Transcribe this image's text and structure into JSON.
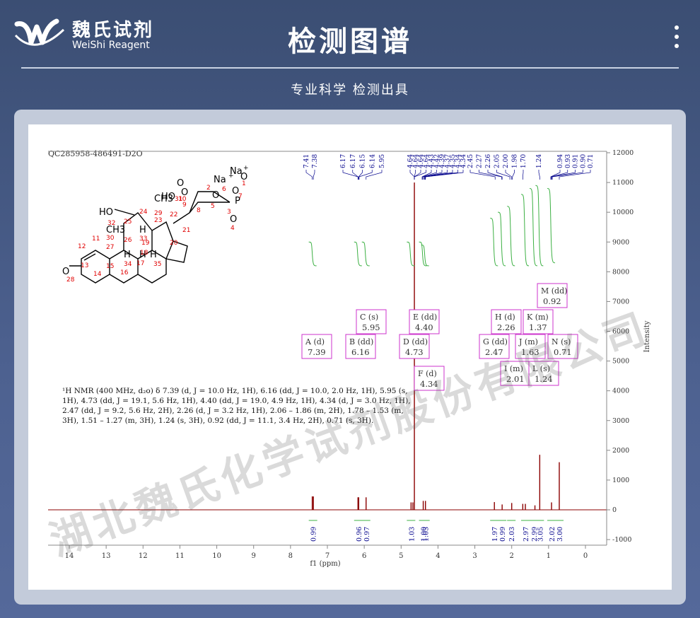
{
  "header": {
    "brand_cn": "魏氏试剂",
    "brand_en": "WeiShi Reagent",
    "title": "检测图谱",
    "subtitle": "专业科学  检测出具"
  },
  "spectrum": {
    "sample_id": "QC285958-486491-D2O",
    "nmr_text": [
      "¹H NMR (400 MHz, d₂o) δ 7.39 (d, J = 10.0 Hz, 1H), 6.16 (dd, J = 10.0, 2.0 Hz, 1H), 5.95 (s,",
      "1H), 4.73 (dd, J = 19.1, 5.6 Hz, 1H), 4.40 (dd, J = 19.0, 4.9 Hz, 1H), 4.34 (d, J = 3.0 Hz, 1H),",
      "2.47 (dd, J = 9.2, 5.6 Hz, 2H), 2.26 (d, J = 3.2 Hz, 1H), 2.06 – 1.86 (m, 2H), 1.78 – 1.53 (m,",
      "3H), 1.51 – 1.27 (m, 3H), 1.24 (s, 3H), 0.92 (dd, J = 11.1, 3.4 Hz, 2H), 0.71 (s, 3H)."
    ],
    "watermark": "湖北魏氏化学试剂股份有限公司"
  },
  "chart_data": {
    "type": "line",
    "xlabel": "f1 (ppm)",
    "ylabel": "Intensity",
    "xlim": [
      14.5,
      -0.6
    ],
    "ylim": [
      -1100,
      12100
    ],
    "x_ticks": [
      "14",
      "13",
      "12",
      "11",
      "10",
      "9",
      "8",
      "7",
      "6",
      "5",
      "4",
      "3",
      "2",
      "1",
      "0"
    ],
    "y_ticks": [
      "12000",
      "11000",
      "10000",
      "9000",
      "8000",
      "7000",
      "6000",
      "5000",
      "4000",
      "3000",
      "2000",
      "1000",
      "0",
      "-1000"
    ],
    "top_labels": [
      "7.41",
      "7.38",
      "6.17",
      "6.17",
      "6.15",
      "6.14",
      "5.95",
      "4.64",
      "4.64",
      "4.64",
      "4.64",
      "4.43",
      "4.42",
      "4.39",
      "4.37",
      "4.35",
      "4.34",
      "4.34",
      "2.45",
      "2.27",
      "2.26",
      "2.05",
      "2.00",
      "1.98",
      "1.70",
      "1.24",
      "0.94",
      "0.93",
      "0.91",
      "0.90",
      "0.71"
    ],
    "peaks": [
      {
        "x": 7.41,
        "y": 450
      },
      {
        "x": 7.38,
        "y": 450
      },
      {
        "x": 6.17,
        "y": 420
      },
      {
        "x": 6.15,
        "y": 420
      },
      {
        "x": 5.95,
        "y": 420
      },
      {
        "x": 4.73,
        "y": 250
      },
      {
        "x": 4.68,
        "y": 250
      },
      {
        "x": 4.64,
        "y": 11000
      },
      {
        "x": 4.4,
        "y": 300
      },
      {
        "x": 4.34,
        "y": 300
      },
      {
        "x": 2.47,
        "y": 260
      },
      {
        "x": 2.26,
        "y": 180
      },
      {
        "x": 2.0,
        "y": 230
      },
      {
        "x": 1.7,
        "y": 200
      },
      {
        "x": 1.63,
        "y": 200
      },
      {
        "x": 1.37,
        "y": 150
      },
      {
        "x": 1.24,
        "y": 1850
      },
      {
        "x": 0.92,
        "y": 250
      },
      {
        "x": 0.71,
        "y": 1600
      }
    ],
    "integrals": [
      {
        "x": 7.39,
        "value": "0.99"
      },
      {
        "x": 6.16,
        "value": "0.96"
      },
      {
        "x": 5.95,
        "value": "0.97"
      },
      {
        "x": 4.73,
        "value": "1.03"
      },
      {
        "x": 4.4,
        "value": "1.00"
      },
      {
        "x": 4.34,
        "value": "1.03"
      },
      {
        "x": 2.47,
        "value": "1.97"
      },
      {
        "x": 2.26,
        "value": "0.99"
      },
      {
        "x": 2.01,
        "value": "2.03"
      },
      {
        "x": 1.63,
        "value": "2.97"
      },
      {
        "x": 1.4,
        "value": "2.99"
      },
      {
        "x": 1.24,
        "value": "3.05"
      },
      {
        "x": 0.92,
        "value": "2.02"
      },
      {
        "x": 0.71,
        "value": "3.00"
      }
    ],
    "multiplets": [
      {
        "id": "A",
        "mult": "d",
        "ppm": "7.39"
      },
      {
        "id": "B",
        "mult": "dd",
        "ppm": "6.16"
      },
      {
        "id": "C",
        "mult": "s",
        "ppm": "5.95"
      },
      {
        "id": "D",
        "mult": "dd",
        "ppm": "4.73"
      },
      {
        "id": "E",
        "mult": "dd",
        "ppm": "4.40"
      },
      {
        "id": "F",
        "mult": "d",
        "ppm": "4.34"
      },
      {
        "id": "G",
        "mult": "dd",
        "ppm": "2.47"
      },
      {
        "id": "H",
        "mult": "d",
        "ppm": "2.26"
      },
      {
        "id": "I",
        "mult": "m",
        "ppm": "2.01"
      },
      {
        "id": "J",
        "mult": "m",
        "ppm": "1.63"
      },
      {
        "id": "K",
        "mult": "m",
        "ppm": "1.37"
      },
      {
        "id": "L",
        "mult": "s",
        "ppm": "1.24"
      },
      {
        "id": "M",
        "mult": "dd",
        "ppm": "0.92"
      },
      {
        "id": "N",
        "mult": "s",
        "ppm": "0.71"
      }
    ],
    "structure_labels": [
      "Na",
      "+",
      "Na",
      "+",
      "O",
      "O",
      "O",
      "P",
      "O",
      "O",
      "O",
      "HO",
      "HO",
      "CH3",
      "CH3",
      "H",
      "H",
      "H",
      "H",
      "O"
    ],
    "structure_numbers": [
      "1",
      "2",
      "3",
      "4",
      "5",
      "6",
      "7",
      "8",
      "9",
      "10",
      "11",
      "12",
      "13",
      "14",
      "15",
      "16",
      "17",
      "18",
      "19",
      "20",
      "21",
      "22",
      "23",
      "24",
      "25",
      "26",
      "27",
      "28",
      "29",
      "30",
      "31",
      "32",
      "33",
      "34",
      "35"
    ],
    "colors": {
      "spectrum": "#8b0000",
      "integral": "#3cb043",
      "label_box": "#cc33cc",
      "top_labels": "#00008b",
      "atom_numbers": "#e00000"
    }
  }
}
